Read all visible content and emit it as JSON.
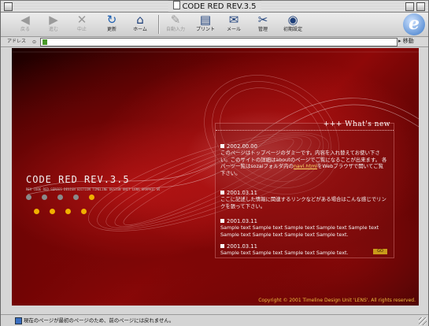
{
  "window": {
    "title": "CODE RED REV.3.5"
  },
  "toolbar": {
    "buttons": [
      {
        "label": "戻る",
        "icon": "◀",
        "disabled": true
      },
      {
        "label": "進む",
        "icon": "▶",
        "disabled": true
      },
      {
        "label": "中止",
        "icon": "✕",
        "disabled": true
      },
      {
        "label": "更新",
        "icon": "↻",
        "disabled": false
      },
      {
        "label": "ホーム",
        "icon": "⌂",
        "disabled": false
      },
      {
        "label": "自動入力",
        "icon": "✎",
        "disabled": true
      },
      {
        "label": "プリント",
        "icon": "▤",
        "disabled": false
      },
      {
        "label": "メール",
        "icon": "✉",
        "disabled": false
      },
      {
        "label": "管理",
        "icon": "✂",
        "disabled": false
      },
      {
        "label": "初期設定",
        "icon": "◉",
        "disabled": false
      }
    ]
  },
  "address": {
    "label": "アドレス",
    "value": "",
    "go_label": "移動"
  },
  "page": {
    "logo_title": "CODE RED REV.3.5",
    "logo_tagline": "REV CODE RED SERIES DESIGN EDITION TIMELINE DESIGN UNIT LENS GRAPHIC WORKS",
    "dots_row1": [
      "#8a8a8a",
      "#8a8a8a",
      "#8a8a8a",
      "#8a8a8a"
    ],
    "dots_row2": [
      "#f0b000",
      "#f0b000",
      "#f0b000",
      "#f0b000",
      "#f0b000"
    ],
    "whats_new_title": "+++ What's new",
    "news": [
      {
        "date": "2002.00.00",
        "text_before": "このページはトップページのダミーです。内容を入れ替えてお使い下さい。このサイトの詳細はaboutのページでご覧になることが出来ます。 各パーツ一覧はsozaiフォルダ内の",
        "link": "navi.html",
        "text_after": "をWebブラウザで開いてご覧下さい。"
      },
      {
        "date": "2001.03.11",
        "text_before": "ここに記述した情報に関連するリンクなどがある場合はこんな感じでリンクを張って下さい。",
        "link": "",
        "text_after": ""
      },
      {
        "date": "2001.03.11",
        "text_before": "Sample text Sample text Sample text Sample text Sample text Sample text Sample text Sample text Sample text.",
        "link": "",
        "text_after": ""
      },
      {
        "date": "2001.03.11",
        "text_before": "Sample text Sample text Sample text Sample text.",
        "link": "",
        "text_after": ""
      }
    ],
    "go_badge": "GO",
    "copyright": "Copyright © 2001 Timeline Design Unit 'LENS'. All rights reserved."
  },
  "status": {
    "text": "現在のページが最初のページのため、前のページには戻れません。"
  },
  "colors": {
    "accent_red": "#8e0808",
    "gold": "#f0c040",
    "link": "#ffdd66"
  }
}
